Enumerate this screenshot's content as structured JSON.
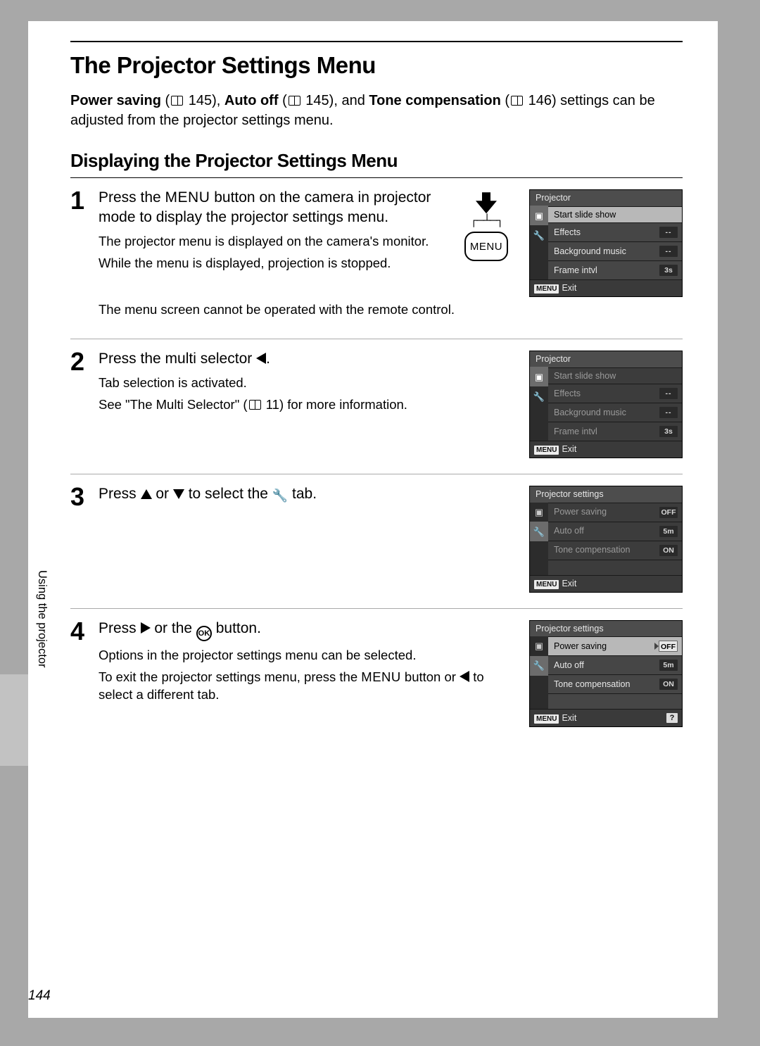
{
  "title": "The Projector Settings Menu",
  "intro": {
    "ps": "Power saving",
    "ps_page": "145",
    "ao": "Auto off",
    "ao_page": "145",
    "tc": "Tone compensation",
    "tc_page": "146",
    "tail": "settings can be adjusted from the projector settings menu."
  },
  "subtitle": "Displaying the Projector Settings Menu",
  "side_label": "Using the projector",
  "page_number": "144",
  "menu_word": "MENU",
  "ok_label": "OK",
  "steps": {
    "s1": {
      "num": "1",
      "lead_a": "Press the ",
      "lead_b": " button on the camera in projector mode to display the projector settings menu.",
      "sub1": "The projector menu is displayed on the camera's monitor.",
      "sub2": "While the menu is displayed, projection is stopped.",
      "sub3": "The menu screen cannot be operated with the remote control.",
      "button_label": "MENU"
    },
    "s2": {
      "num": "2",
      "lead_a": "Press the multi selector ",
      "lead_b": ".",
      "sub1": "Tab selection is activated.",
      "sub2a": "See \"The Multi Selector\" (",
      "sub2_page": "11",
      "sub2b": ") for more information."
    },
    "s3": {
      "num": "3",
      "lead_a": "Press ",
      "lead_mid": " or ",
      "lead_b": " to select the ",
      "lead_c": " tab."
    },
    "s4": {
      "num": "4",
      "lead_a": "Press ",
      "lead_mid": " or the ",
      "lead_b": " button.",
      "sub1": "Options in the projector settings menu can be selected.",
      "sub2a": "To exit the projector settings menu, press the ",
      "sub2b": " button or ",
      "sub2c": " to select a different tab."
    }
  },
  "lcd_projector": {
    "title": "Projector",
    "start": "Start slide show",
    "effects": "Effects",
    "bgmusic": "Background music",
    "frameintvl": "Frame intvl",
    "frameintvl_val": "3s",
    "exit": "Exit"
  },
  "lcd_settings": {
    "title": "Projector settings",
    "ps": "Power saving",
    "ps_val": "OFF",
    "ao": "Auto off",
    "ao_val": "5m",
    "tc": "Tone compensation",
    "tc_val": "ON",
    "exit": "Exit",
    "help": "?"
  }
}
